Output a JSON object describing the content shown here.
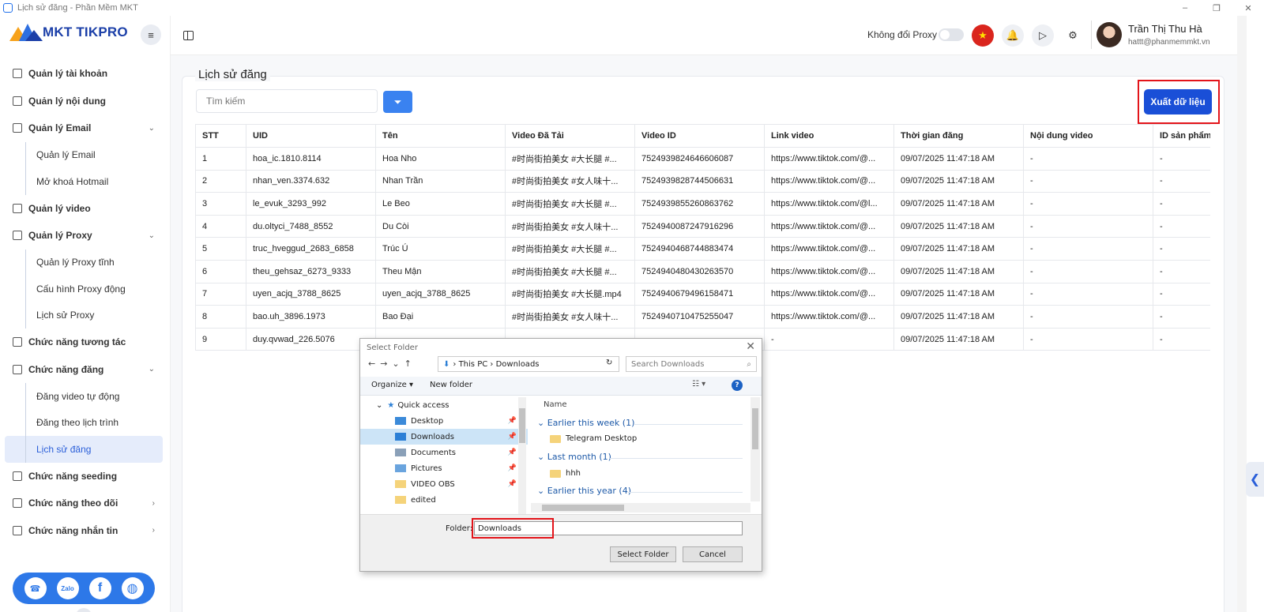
{
  "window": {
    "title": "Lịch sử đăng - Phần Mềm MKT",
    "controls": [
      "–",
      "❐",
      "✕"
    ]
  },
  "brand": {
    "name": "MKT TIKPRO"
  },
  "sidebar": {
    "items": [
      {
        "label": "Quản lý tài khoản",
        "type": "item"
      },
      {
        "label": "Quản lý nội dung",
        "type": "item"
      },
      {
        "label": "Quản lý Email",
        "type": "group",
        "chevron": "⌄"
      },
      {
        "label": "Quản lý Email",
        "type": "sub"
      },
      {
        "label": "Mở khoá Hotmail",
        "type": "sub"
      },
      {
        "label": "Quản lý video",
        "type": "item"
      },
      {
        "label": "Quản lý Proxy",
        "type": "group",
        "chevron": "⌄"
      },
      {
        "label": "Quản lý Proxy tĩnh",
        "type": "sub"
      },
      {
        "label": "Cấu hình Proxy động",
        "type": "sub"
      },
      {
        "label": "Lịch sử Proxy",
        "type": "sub"
      },
      {
        "label": "Chức năng tương tác",
        "type": "item"
      },
      {
        "label": "Chức năng đăng",
        "type": "group",
        "chevron": "⌄"
      },
      {
        "label": "Đăng video tự động",
        "type": "sub"
      },
      {
        "label": "Đăng theo lịch trình",
        "type": "sub"
      },
      {
        "label": "Lịch sử đăng",
        "type": "sub",
        "active": true
      },
      {
        "label": "Chức năng seeding",
        "type": "item"
      },
      {
        "label": "Chức năng theo dõi",
        "type": "item",
        "chevron": "›"
      },
      {
        "label": "Chức năng nhắn tin",
        "type": "item",
        "chevron": "›"
      }
    ],
    "social": {
      "zalo": "Zalo",
      "facebook": "f",
      "web": "◍",
      "support": "☎"
    }
  },
  "header": {
    "proxy_label": "Không đổi Proxy",
    "proxy_toggle_on": false,
    "user_name": "Trần Thị Thu Hà",
    "user_email": "hattt@phanmemmkt.vn"
  },
  "page": {
    "title": "Lịch sử đăng",
    "search_placeholder": "Tìm kiếm",
    "export_label": "Xuất dữ liệu"
  },
  "table": {
    "columns": [
      "STT",
      "UID",
      "Tên",
      "Video Đã Tải",
      "Video ID",
      "Link video",
      "Thời gian đăng",
      "Nội dung video",
      "ID sản phẩm"
    ],
    "rows": [
      [
        "1",
        "hoa_ic.1810.8114",
        "Hoa Nho",
        "#时尚街拍美女 #大长腿 #...",
        "7524939824646606087",
        "https://www.tiktok.com/@...",
        "09/07/2025 11:47:18 AM",
        "-",
        "-"
      ],
      [
        "2",
        "nhan_ven.3374.632",
        "Nhan Trần",
        "#时尚街拍美女 #女人味十...",
        "7524939828744506631",
        "https://www.tiktok.com/@...",
        "09/07/2025 11:47:18 AM",
        "-",
        "-"
      ],
      [
        "3",
        "le_evuk_3293_992",
        "Le Beo",
        "#时尚街拍美女 #大长腿 #...",
        "7524939855260863762",
        "https://www.tiktok.com/@l...",
        "09/07/2025 11:47:18 AM",
        "-",
        "-"
      ],
      [
        "4",
        "du.oltyci_7488_8552",
        "Du Còi",
        "#时尚街拍美女 #女人味十...",
        "7524940087247916296",
        "https://www.tiktok.com/@...",
        "09/07/2025 11:47:18 AM",
        "-",
        "-"
      ],
      [
        "5",
        "truc_hveggud_2683_6858",
        "Trúc Ú",
        "#时尚街拍美女 #大长腿 #...",
        "7524940468744883474",
        "https://www.tiktok.com/@...",
        "09/07/2025 11:47:18 AM",
        "-",
        "-"
      ],
      [
        "6",
        "theu_gehsaz_6273_9333",
        "Theu Mận",
        "#时尚街拍美女 #大长腿 #...",
        "7524940480430263570",
        "https://www.tiktok.com/@...",
        "09/07/2025 11:47:18 AM",
        "-",
        "-"
      ],
      [
        "7",
        "uyen_acjq_3788_8625",
        "uyen_acjq_3788_8625",
        "#时尚街拍美女 #大长腿.mp4",
        "7524940679496158471",
        "https://www.tiktok.com/@...",
        "09/07/2025 11:47:18 AM",
        "-",
        "-"
      ],
      [
        "8",
        "bao.uh_3896.1973",
        "Bao Đại",
        "#时尚街拍美女 #女人味十...",
        "7524940710475255047",
        "https://www.tiktok.com/@...",
        "09/07/2025 11:47:18 AM",
        "-",
        "-"
      ],
      [
        "9",
        "duy.qvwad_226.5076",
        "",
        "",
        "",
        "-",
        "09/07/2025 11:47:18 AM",
        "-",
        "-"
      ]
    ]
  },
  "dialog": {
    "title": "Select Folder",
    "path": [
      "This PC",
      "Downloads"
    ],
    "search_placeholder": "Search Downloads",
    "organize": "Organize ▾",
    "new_folder": "New folder",
    "tree": [
      {
        "label": "Quick access",
        "kind": "qa"
      },
      {
        "label": "Desktop",
        "pinned": true
      },
      {
        "label": "Downloads",
        "pinned": true,
        "selected": true
      },
      {
        "label": "Documents",
        "pinned": true
      },
      {
        "label": "Pictures",
        "pinned": true
      },
      {
        "label": "VIDEO OBS",
        "pinned": true
      },
      {
        "label": "edited",
        "pinned": false
      }
    ],
    "column_name": "Name",
    "groups": [
      {
        "label": "Earlier this week (1)",
        "items": [
          "Telegram Desktop"
        ]
      },
      {
        "label": "Last month (1)",
        "items": [
          "hhh"
        ]
      },
      {
        "label": "Earlier this year (4)",
        "items": []
      }
    ],
    "folder_label": "Folder:",
    "folder_value": "Downloads",
    "select_button": "Select Folder",
    "cancel_button": "Cancel"
  }
}
